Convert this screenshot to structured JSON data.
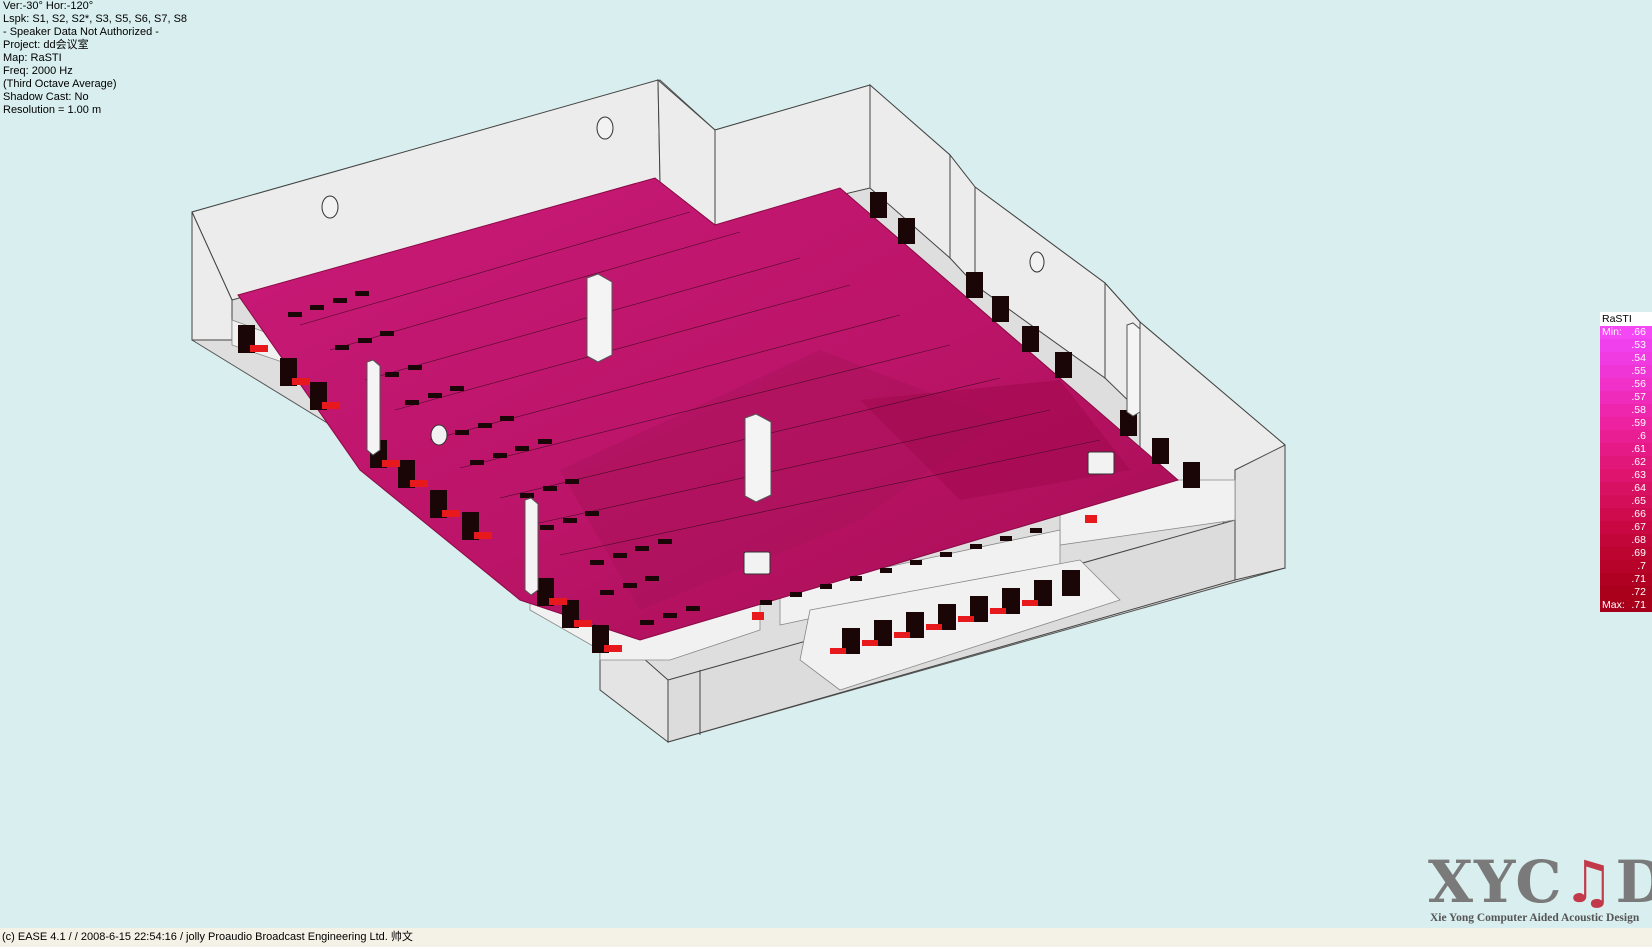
{
  "info": {
    "view": "Ver:-30°   Hor:-120°",
    "loudspeakers": "Lspk: S1, S2, S2*, S3, S5, S6, S7, S8",
    "authorization": "- Speaker Data Not Authorized -",
    "project": "Project: dd会议室",
    "map": "Map: RaSTI",
    "frequency": "Freq: 2000 Hz",
    "averaging": "(Third Octave Average)",
    "shadow": "Shadow Cast: No",
    "resolution": "Resolution =   1.00 m"
  },
  "legend": {
    "title": "RaSTI",
    "min_label": "Min:",
    "min_value": ".66",
    "max_label": "Max:",
    "max_value": ".71",
    "levels": [
      {
        "value": ".53",
        "color": "#f040ee"
      },
      {
        "value": ".54",
        "color": "#f03ae2"
      },
      {
        "value": ".55",
        "color": "#f035d6"
      },
      {
        "value": ".56",
        "color": "#f030c8"
      },
      {
        "value": ".57",
        "color": "#ef2bbb"
      },
      {
        "value": ".58",
        "color": "#ee26ae"
      },
      {
        "value": ".59",
        "color": "#ec22a0"
      },
      {
        "value": ".6",
        "color": "#ea1e93"
      },
      {
        "value": ".61",
        "color": "#e61a86"
      },
      {
        "value": ".62",
        "color": "#e2177a"
      },
      {
        "value": ".63",
        "color": "#de146e"
      },
      {
        "value": ".64",
        "color": "#d91163"
      },
      {
        "value": ".65",
        "color": "#d40e58"
      },
      {
        "value": ".66",
        "color": "#cf0b4d"
      },
      {
        "value": ".67",
        "color": "#c90843"
      },
      {
        "value": ".68",
        "color": "#c3063a"
      },
      {
        "value": ".69",
        "color": "#bd0431"
      },
      {
        "value": ".7",
        "color": "#b70229"
      },
      {
        "value": ".71",
        "color": "#b10122"
      },
      {
        "value": ".72",
        "color": "#ab001b"
      }
    ],
    "min_color": "#f548f5",
    "max_color": "#a8001a"
  },
  "footer": {
    "text": "(c) EASE 4.1  /   / 2008-6-15 22:54:16 / jolly Proaudio Broadcast Engineering Ltd. 帅文"
  },
  "logo": {
    "brand_prefix": "XYC",
    "brand_note": "♫",
    "brand_suffix": "D",
    "subtitle": "Xie Yong Computer Aided Acoustic Design"
  },
  "colors": {
    "background": "#d9eeee",
    "wall": "#e6e6e6",
    "audience_plane": "#c2166c",
    "chair_back": "#1a0606",
    "chair_seat": "#e8191c"
  }
}
